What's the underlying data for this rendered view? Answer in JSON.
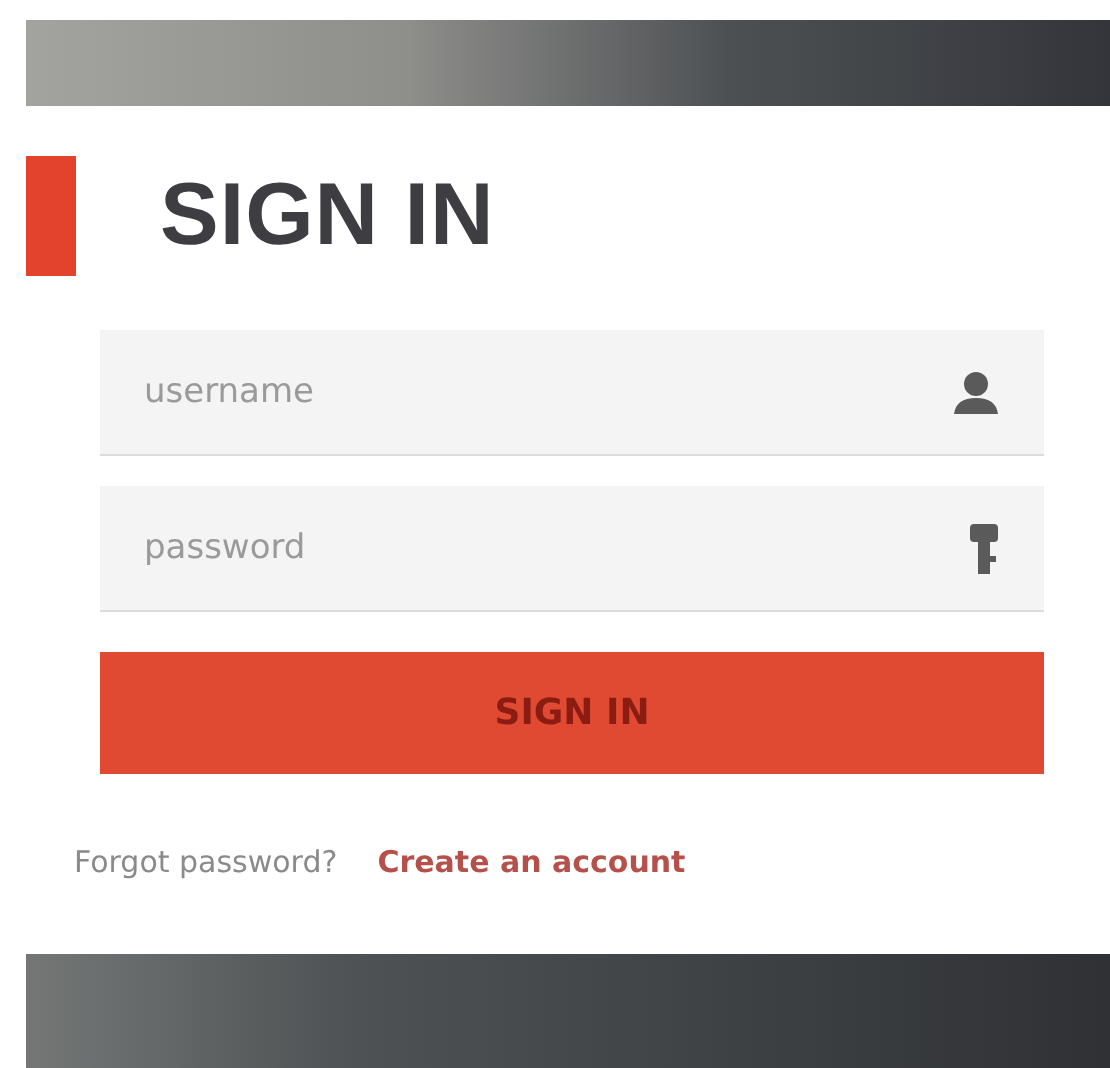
{
  "title": "SIGN IN",
  "fields": [
    {
      "kind": "user",
      "placeholder": "username"
    },
    {
      "kind": "key",
      "placeholder": "password"
    }
  ],
  "submit": "SIGN IN",
  "links": [
    {
      "label": "Forgot password?",
      "kind": "muted"
    },
    {
      "label": "Create an account",
      "kind": "accent"
    }
  ]
}
